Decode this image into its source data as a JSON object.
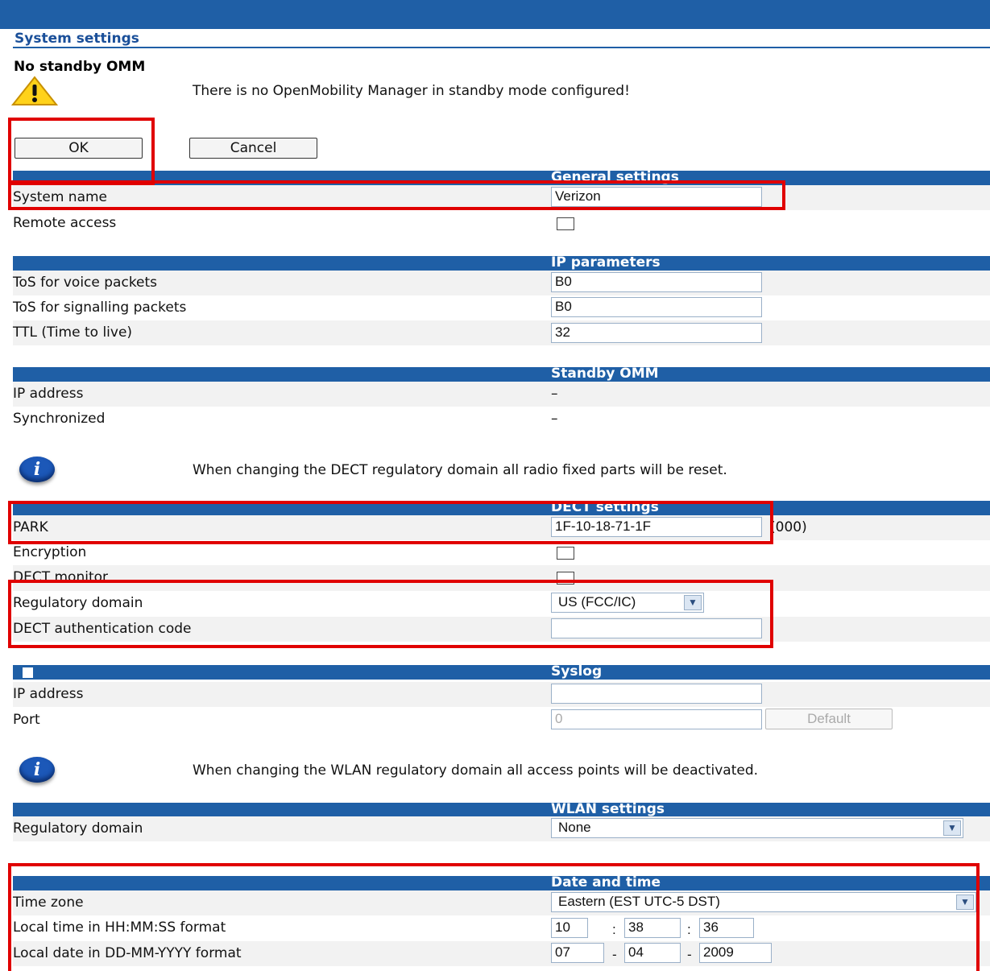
{
  "page": {
    "title": "System settings"
  },
  "warning": {
    "title": "No standby OMM",
    "message": "There is no OpenMobility Manager in standby mode configured!",
    "icon": "warning-icon"
  },
  "buttons": {
    "ok": "OK",
    "cancel": "Cancel"
  },
  "general": {
    "header": "General settings",
    "system_name_label": "System name",
    "system_name_value": "Verizon",
    "remote_access_label": "Remote access",
    "remote_access_checked": false
  },
  "ip": {
    "header": "IP parameters",
    "tos_voice_label": "ToS for voice packets",
    "tos_voice_value": "B0",
    "tos_signalling_label": "ToS for signalling packets",
    "tos_signalling_value": "B0",
    "ttl_label": "TTL (Time to live)",
    "ttl_value": "32"
  },
  "standby": {
    "header": "Standby OMM",
    "ip_label": "IP address",
    "ip_value": "–",
    "sync_label": "Synchronized",
    "sync_value": "–"
  },
  "dect_info": "When changing the DECT regulatory domain all radio fixed parts will be reset.",
  "dect": {
    "header": "DECT settings",
    "park_label": "PARK",
    "park_value": "1F-10-18-71-1F",
    "park_suffix": "(000)",
    "encryption_label": "Encryption",
    "monitor_label": "DECT monitor",
    "regdomain_label": "Regulatory domain",
    "regdomain_value": "US (FCC/IC)",
    "auth_label": "DECT authentication code",
    "auth_value": ""
  },
  "syslog": {
    "header": "Syslog",
    "ip_label": "IP address",
    "ip_value": "",
    "port_label": "Port",
    "port_placeholder": "0",
    "default_button": "Default"
  },
  "wlan_info": "When changing the WLAN regulatory domain all access points will be deactivated.",
  "wlan": {
    "header": "WLAN settings",
    "regdomain_label": "Regulatory domain",
    "regdomain_value": "None"
  },
  "datetime": {
    "header": "Date and time",
    "timezone_label": "Time zone",
    "timezone_value": "Eastern (EST UTC-5 DST)",
    "time_label": "Local time in HH:MM:SS format",
    "hh": "10",
    "mm": "38",
    "ss": "36",
    "time_sep": ":",
    "date_label": "Local date in DD-MM-YYYY format",
    "dd": "07",
    "month": "04",
    "yyyy": "2009",
    "date_sep": "-"
  },
  "colors": {
    "header_blue": "#1f5fa6",
    "highlight_red": "#e00000",
    "row_shade": "#f2f2f2"
  }
}
